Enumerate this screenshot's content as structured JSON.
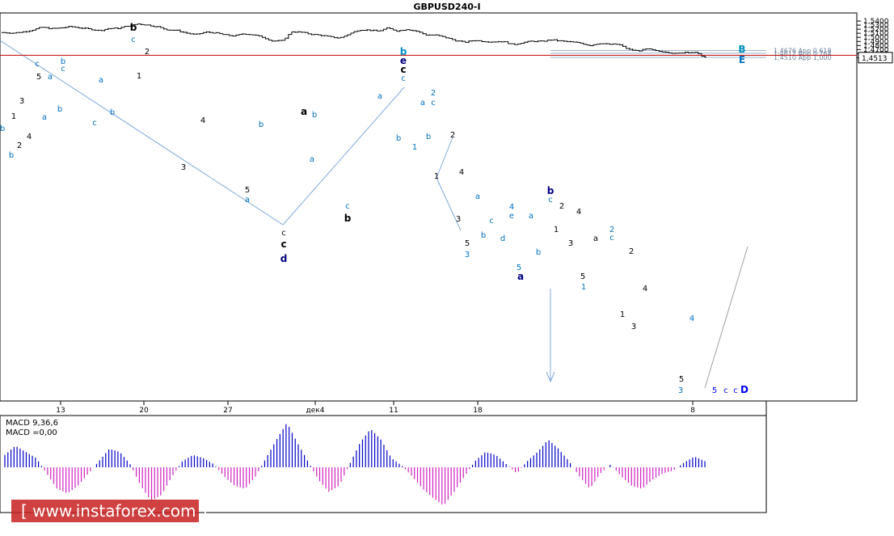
{
  "chart_data": {
    "type": "candlestick",
    "title": "GBPUSD240-I",
    "symbol": "GBPUSD",
    "timeframe": "240",
    "y_ticks": [
      "1,5400",
      "1,5300",
      "1,5200",
      "1,5100",
      "1,5000",
      "1,4900",
      "1,4800",
      "1,4700",
      "1,4600",
      "1,4500"
    ],
    "ylim": [
      1.4475,
      1.5425
    ],
    "x_ticks": [
      "13",
      "20",
      "27",
      "дек4",
      "11",
      "18",
      "8"
    ],
    "current_price": 1.4513,
    "current_price_label": "1,4513",
    "support_line_price": 1.4562,
    "fibonacci_levels": [
      {
        "price": 1.4676,
        "label": "1,4676 App 0,618"
      },
      {
        "price": 1.4612,
        "label": "1,4612 App 0,764"
      },
      {
        "price": 1.451,
        "label": "1,4510 App 1,000"
      }
    ],
    "wave_labels": [
      {
        "text": "b",
        "color": "#000000"
      },
      {
        "text": "c",
        "color": "#000080"
      },
      {
        "text": "d",
        "color": "#000080"
      },
      {
        "text": "b",
        "color": "#0070c0"
      },
      {
        "text": "e",
        "color": "#000080"
      },
      {
        "text": "c",
        "color": "#000000"
      },
      {
        "text": "B",
        "color": "#0090c0"
      },
      {
        "text": "E",
        "color": "#0070c0"
      },
      {
        "text": "a",
        "color": "#000080"
      },
      {
        "text": "D",
        "color": "#0000ff"
      },
      {
        "text": "c",
        "color": "#0000ff"
      },
      {
        "text": "3",
        "color": "#0000ff"
      },
      {
        "text": "1",
        "color": "#0000ff"
      },
      {
        "text": "5",
        "color": "#0000ff"
      }
    ],
    "price_path": [
      1.5118,
      1.5105,
      1.5132,
      1.5178,
      1.5248,
      1.5212,
      1.523,
      1.5265,
      1.5231,
      1.5202,
      1.5166,
      1.5218,
      1.5222,
      1.5285,
      1.533,
      1.5301,
      1.526,
      1.519,
      1.5171,
      1.5108,
      1.5063,
      1.5128,
      1.5112,
      1.5062,
      1.5033,
      1.509,
      1.5062,
      1.5003,
      1.491,
      1.4916,
      1.5138,
      1.5125,
      1.5078,
      1.5053,
      1.5011,
      1.4982,
      1.5086,
      1.5185,
      1.518,
      1.515,
      1.5228,
      1.5156,
      1.52,
      1.515,
      1.506,
      1.5055,
      1.4998,
      1.4925,
      1.488,
      1.4928,
      1.49,
      1.4891,
      1.49,
      1.482,
      1.487,
      1.4906,
      1.49,
      1.494,
      1.491,
      1.4887,
      1.4862,
      1.48,
      1.4855,
      1.4827,
      1.483,
      1.4708,
      1.4666,
      1.4718,
      1.4662,
      1.4645,
      1.4597,
      1.4643,
      1.4625,
      1.4513
    ],
    "macd": {
      "label": "MACD 9,36,6",
      "value_label": "MACD =0,00",
      "values": [
        0.4,
        0.7,
        0.5,
        0.3,
        -0.2,
        -0.7,
        -0.85,
        -0.6,
        -0.2,
        0.2,
        0.6,
        0.5,
        0.1,
        -0.6,
        -1.1,
        -0.9,
        -0.3,
        0.2,
        0.4,
        0.3,
        0.1,
        -0.3,
        -0.6,
        -0.7,
        -0.3,
        0.3,
        0.9,
        1.45,
        0.8,
        0.2,
        -0.4,
        -0.8,
        -0.6,
        0.1,
        0.8,
        1.25,
        0.9,
        0.3,
        0.05,
        -0.3,
        -0.7,
        -1.0,
        -1.25,
        -0.8,
        -0.3,
        0.2,
        0.5,
        0.4,
        0.1,
        -0.2,
        0.2,
        0.5,
        0.9,
        0.6,
        0.2,
        -0.3,
        -0.7,
        -0.2,
        0.1,
        -0.3,
        -0.6,
        -0.7,
        -0.4,
        -0.2,
        -0.1,
        0.15,
        0.35,
        0.2
      ],
      "ylim": [
        -1.6,
        1.6
      ]
    }
  },
  "watermark": "[ www.instaforex.com ]",
  "price_box_label": "1,4513",
  "colors": {
    "support_line": "#c00000",
    "fib_line": "#9ab4cc",
    "macd_pos": "#0000c8",
    "macd_neg": "#d020c0",
    "trend_line": "#7fa8d8"
  }
}
